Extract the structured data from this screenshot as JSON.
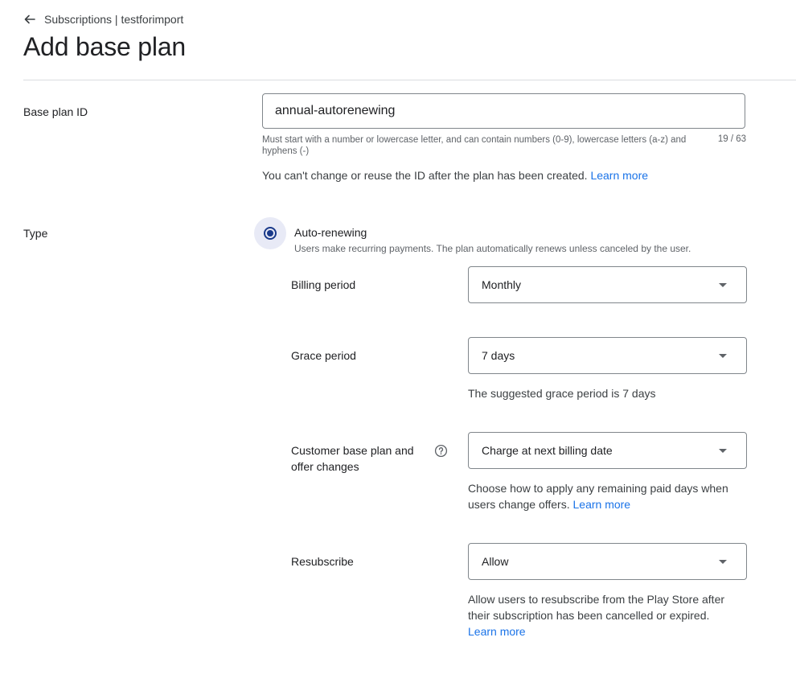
{
  "header": {
    "breadcrumb": "Subscriptions | testforimport",
    "title": "Add base plan"
  },
  "base_plan_id": {
    "label": "Base plan ID",
    "value": "annual-autorenewing",
    "helper": "Must start with a number or lowercase letter, and can contain numbers (0-9), lowercase letters (a-z) and hyphens (-)",
    "counter": "19 / 63",
    "note": "You can't change or reuse the ID after the plan has been created.",
    "learn_more": "Learn more"
  },
  "type": {
    "label": "Type",
    "option_label": "Auto-renewing",
    "option_desc": "Users make recurring payments. The plan automatically renews unless canceled by the user.",
    "selected": true
  },
  "billing_period": {
    "label": "Billing period",
    "value": "Monthly"
  },
  "grace_period": {
    "label": "Grace period",
    "value": "7 days",
    "hint": "The suggested grace period is 7 days"
  },
  "customer_changes": {
    "label": "Customer base plan and offer changes",
    "value": "Charge at next billing date",
    "hint": "Choose how to apply any remaining paid days when users change offers.",
    "learn_more": "Learn more",
    "help_icon": "help-circle-icon"
  },
  "resubscribe": {
    "label": "Resubscribe",
    "value": "Allow",
    "hint": "Allow users to resubscribe from the Play Store after their subscription has been cancelled or expired.",
    "learn_more": "Learn more"
  },
  "colors": {
    "accent_link": "#1a73e8",
    "radio_selected": "#1a3a8a",
    "radio_halo": "#e8eaf6",
    "border": "#80868b",
    "divider": "#dadce0"
  }
}
